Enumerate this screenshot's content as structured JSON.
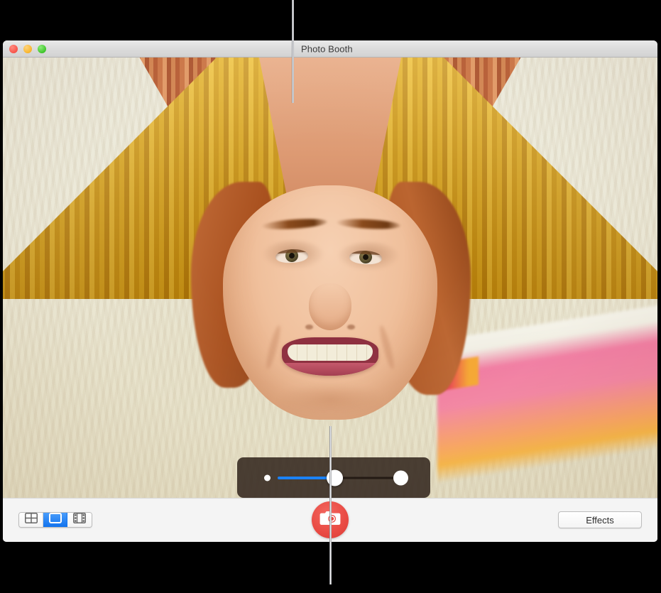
{
  "window": {
    "title": "Photo Booth",
    "traffic_lights": [
      {
        "name": "close",
        "color": "#f8544a"
      },
      {
        "name": "minimize",
        "color": "#f8b52c"
      },
      {
        "name": "zoom",
        "color": "#3fc52a"
      }
    ]
  },
  "preview": {
    "effect_name": "Stretch",
    "subject": "smiling woman with red hair wearing a mustard yellow sweater",
    "background_color": "#e8e4d2",
    "accent_object_color": "#f2829f"
  },
  "slider": {
    "name": "effect-intensity-slider",
    "value_percent": 53,
    "fill_color": "#1b82f5",
    "panel_color": "#30231b",
    "min_label": "",
    "max_label": ""
  },
  "toolbar": {
    "view_modes": [
      {
        "id": "four-up",
        "icon": "grid-4up-icon",
        "label": "4-up",
        "selected": false
      },
      {
        "id": "single",
        "icon": "single-photo-icon",
        "label": "Single photo",
        "selected": true
      },
      {
        "id": "movie",
        "icon": "film-strip-icon",
        "label": "Movie clip",
        "selected": false
      }
    ],
    "capture": {
      "icon": "camera-icon",
      "label": "Take Photo",
      "color": "#e94a43"
    },
    "effects": {
      "label": "Effects"
    }
  },
  "callouts": [
    {
      "id": "callout-top",
      "target": "window-title"
    },
    {
      "id": "callout-slider",
      "target": "effect-intensity-slider"
    },
    {
      "id": "callout-bottom",
      "target": "capture-button"
    }
  ]
}
